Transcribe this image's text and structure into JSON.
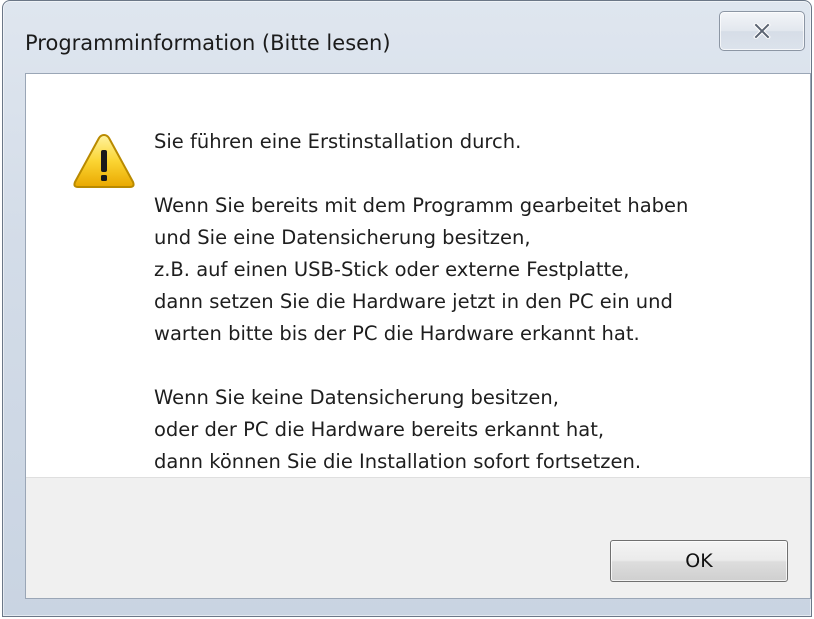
{
  "window": {
    "title": "Programminformation (Bitte lesen)",
    "close_icon": "close-x-icon"
  },
  "message": {
    "icon": "warning-triangle-icon",
    "paragraph1": [
      "Sie führen eine Erstinstallation durch."
    ],
    "paragraph2": [
      "Wenn Sie bereits mit dem Programm gearbeitet haben",
      "und Sie eine Datensicherung besitzen,",
      "z.B. auf einen USB-Stick oder externe Festplatte,",
      "dann setzen Sie die Hardware jetzt in den PC ein und",
      "warten bitte bis der PC die Hardware erkannt hat."
    ],
    "paragraph3": [
      "Wenn Sie keine Datensicherung besitzen,",
      "oder der PC die Hardware bereits erkannt hat,",
      "dann können Sie die Installation sofort fortsetzen."
    ]
  },
  "buttons": {
    "ok_label": "OK"
  },
  "colors": {
    "frame": "#d3dce8",
    "footer": "#f0f0f0",
    "warning": "#f5c400"
  }
}
